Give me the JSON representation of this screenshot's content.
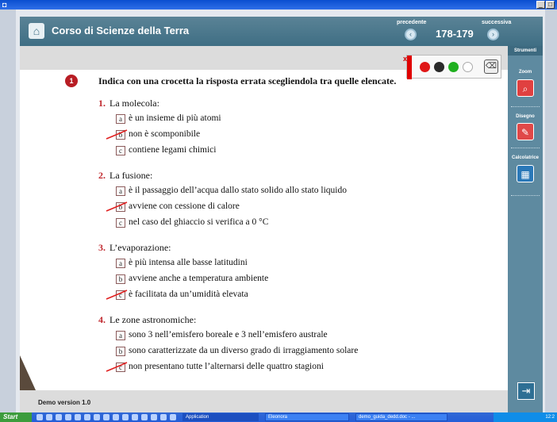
{
  "window": {
    "controls": [
      "_",
      "□"
    ]
  },
  "header": {
    "title": "Corso di Scienze della Terra",
    "prev_label": "precedente",
    "next_label": "successiva",
    "pages": "178-179"
  },
  "palette": {
    "close": "x"
  },
  "sidebar": {
    "heading": "Strumenti",
    "zoom_label": "Zoom",
    "draw_label": "Disegno",
    "calc_label": "Calcolatrice"
  },
  "exercise": {
    "number": "1",
    "instruction": "Indica con una crocetta la risposta errata scegliendola tra quelle elencate.",
    "questions": [
      {
        "num": "1.",
        "text": "La molecola:",
        "options": [
          {
            "letter": "a",
            "text": "è un insieme di più atomi"
          },
          {
            "letter": "b",
            "text": "non è scomponibile"
          },
          {
            "letter": "c",
            "text": "contiene legami chimici"
          }
        ]
      },
      {
        "num": "2.",
        "text": "La fusione:",
        "options": [
          {
            "letter": "a",
            "text": "è il passaggio dell’acqua dallo stato solido allo stato liquido"
          },
          {
            "letter": "b",
            "text": "avviene con cessione di calore"
          },
          {
            "letter": "c",
            "text": "nel caso del ghiaccio si verifica a 0 °C"
          }
        ]
      },
      {
        "num": "3.",
        "text": "L’evaporazione:",
        "options": [
          {
            "letter": "a",
            "text": "è più intensa alle basse latitudini"
          },
          {
            "letter": "b",
            "text": "avviene anche a temperatura ambiente"
          },
          {
            "letter": "c",
            "text": "è facilitata da un’umidità elevata"
          }
        ]
      },
      {
        "num": "4.",
        "text": "Le zone astronomiche:",
        "options": [
          {
            "letter": "a",
            "text": "sono 3 nell’emisfero boreale e 3 nell’emisfero australe"
          },
          {
            "letter": "b",
            "text": "sono caratterizzate da un diverso grado di irraggiamento solare"
          },
          {
            "letter": "c",
            "text": "non presentano tutte l’alternarsi delle quattro stagioni"
          }
        ]
      }
    ]
  },
  "footer": {
    "version": "Demo version 1.0"
  },
  "taskbar": {
    "start": "Start",
    "tasks": [
      "Application",
      "Eleonora",
      "demo_guida_dedd.doc - ..."
    ],
    "clock": "12:2"
  },
  "colors": {
    "header": "#4d7a8e",
    "sidebar": "#5e8aa0",
    "accent_red": "#c0282e",
    "mark_red": "#e02020"
  }
}
